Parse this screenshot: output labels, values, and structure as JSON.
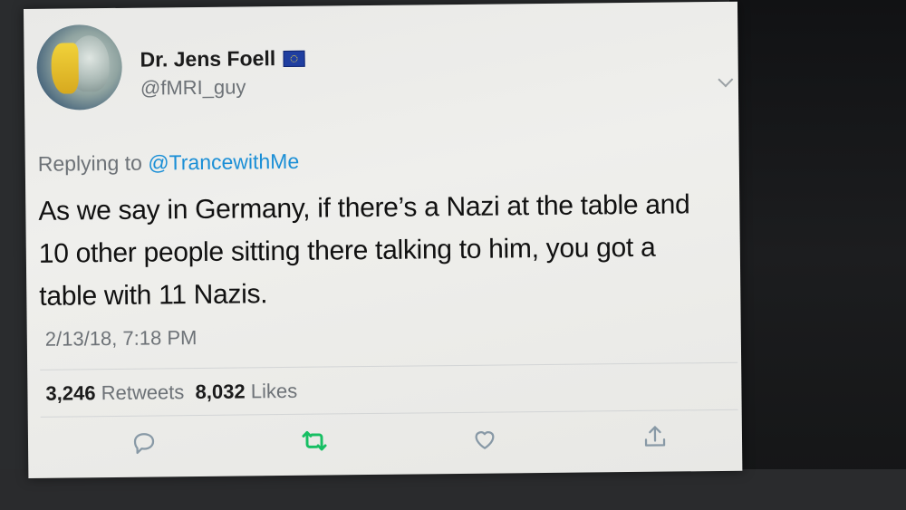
{
  "tweet": {
    "author_name": "Dr. Jens Foell",
    "author_handle": "@fMRI_guy",
    "flag_icon": "eu-flag-icon",
    "replying_prefix": "Replying to",
    "replying_to": "@TrancewithMe",
    "text": "As we say in Germany, if there’s a Nazi at the table and 10 other people sitting there talking to him, you got a table with 11 Nazis.",
    "timestamp": "2/13/18, 7:18 PM",
    "retweets_count": "3,246",
    "retweets_label": "Retweets",
    "likes_count": "8,032",
    "likes_label": "Likes"
  },
  "actions": [
    {
      "name": "reply-icon",
      "color": "#8899a6"
    },
    {
      "name": "retweet-icon",
      "color": "#17bf63"
    },
    {
      "name": "like-icon",
      "color": "#8899a6"
    },
    {
      "name": "share-icon",
      "color": "#8899a6"
    }
  ],
  "colors": {
    "link": "#1b8fd6",
    "retweet_active": "#17bf63",
    "secondary_text": "#6d7277"
  }
}
